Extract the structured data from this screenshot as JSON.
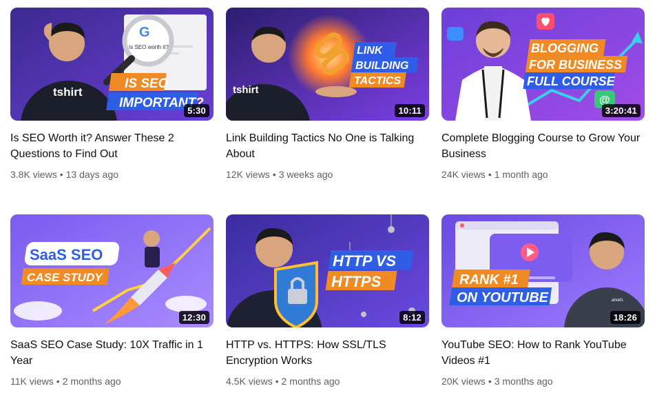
{
  "videos": [
    {
      "title": "Is SEO Worth it? Answer These 2 Questions to Find Out",
      "views": "3.8K views",
      "age": "13 days ago",
      "duration": "5:30",
      "thumb_lines": [
        "IS SEO",
        "IMPORTANT?"
      ],
      "shirt": "tshirt",
      "search_text": "Is SEO worth it?",
      "accent": "#f08a24"
    },
    {
      "title": "Link Building Tactics No One is Talking About",
      "views": "12K views",
      "age": "3 weeks ago",
      "duration": "10:11",
      "thumb_lines": [
        "LINK",
        "BUILDING",
        "TACTICS"
      ],
      "shirt": "tshirt",
      "accent": "#f08a24"
    },
    {
      "title": "Complete Blogging Course to Grow Your Business",
      "views": "24K views",
      "age": "1 month ago",
      "duration": "3:20:41",
      "thumb_lines": [
        "BLOGGING",
        "FOR BUSINESS",
        "FULL COURSE"
      ],
      "accent": "#f08a24"
    },
    {
      "title": "SaaS SEO Case Study: 10X Traffic in 1 Year",
      "views": "11K views",
      "age": "2 months ago",
      "duration": "12:30",
      "thumb_lines": [
        "SaaS SEO",
        "CASE STUDY"
      ],
      "accent": "#f08a24"
    },
    {
      "title": "HTTP vs. HTTPS: How SSL/TLS Encryption Works",
      "views": "4.5K views",
      "age": "2 months ago",
      "duration": "8:12",
      "thumb_lines": [
        "HTTP VS",
        "HTTPS"
      ],
      "accent": "#f08a24"
    },
    {
      "title": "YouTube SEO: How to Rank YouTube Videos #1",
      "views": "20K views",
      "age": "3 months ago",
      "duration": "18:26",
      "thumb_lines": [
        "RANK #1",
        "ON YOUTUBE"
      ],
      "shirt": "ahrefs",
      "accent": "#f08a24"
    }
  ],
  "separator": "•"
}
